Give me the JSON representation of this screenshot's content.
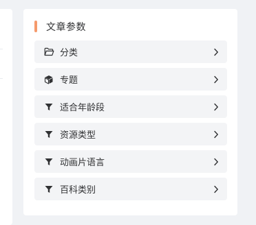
{
  "panel": {
    "title": "文章参数",
    "accent_color": "#f59a6c",
    "items": [
      {
        "label": "分类",
        "icon": "folder-open-icon"
      },
      {
        "label": "专题",
        "icon": "cube-icon"
      },
      {
        "label": "适合年龄段",
        "icon": "filter-icon"
      },
      {
        "label": "资源类型",
        "icon": "filter-icon"
      },
      {
        "label": "动画片语言",
        "icon": "filter-icon"
      },
      {
        "label": "百科类别",
        "icon": "filter-icon"
      }
    ]
  }
}
